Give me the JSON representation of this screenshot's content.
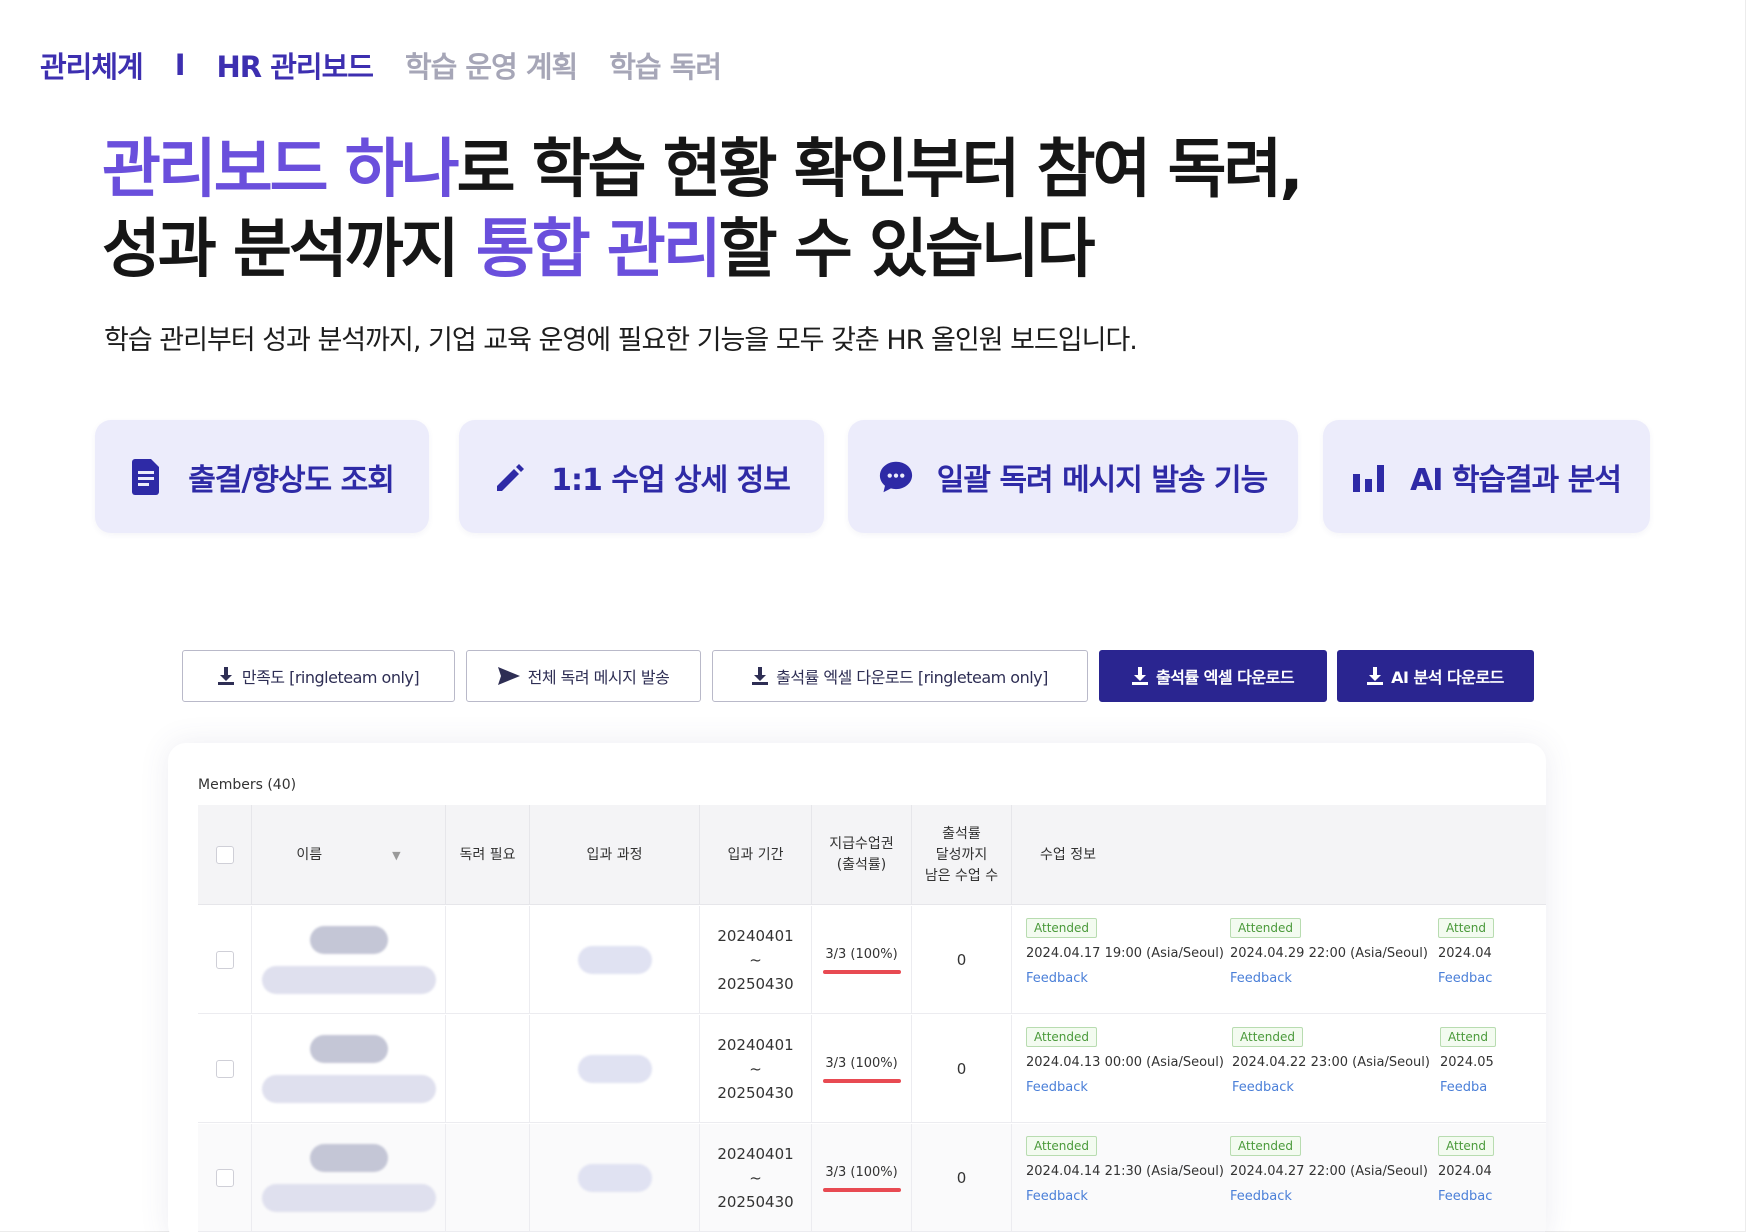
{
  "nav": {
    "item_1": "관리체계",
    "separator": "I",
    "item_2": "HR 관리보드",
    "item_3": "학습 운영 계획",
    "item_4": "학습 독려"
  },
  "hero": {
    "line1_highlight": "관리보드 하나",
    "line1_rest": "로 학습 현황 확인부터 참여 독려,",
    "line2_start": "성과 분석까지 ",
    "line2_highlight": "통합 관리",
    "line2_end": "할 수 있습니다",
    "subtitle": "학습 관리부터 성과 분석까지, 기업 교육 운영에 필요한 기능을 모두 갖춘 HR 올인원 보드입니다.",
    "accent_color": "#6a4fdc"
  },
  "features": [
    {
      "label": "출결/향상도 조회",
      "icon": "document-icon"
    },
    {
      "label": "1:1 수업 상세 정보",
      "icon": "pencil-icon"
    },
    {
      "label": "일괄 독려 메시지 발송 기능",
      "icon": "chat-bubble-icon"
    },
    {
      "label": "AI 학습결과 분석",
      "icon": "bar-chart-icon"
    }
  ],
  "toolbar": {
    "btn_satisfaction": "만족도 [ringleteam only]",
    "btn_send_all": "전체 독려 메시지 발송",
    "btn_attendance_excel_team": "출석률 엑셀 다운로드 [ringleteam only]",
    "btn_attendance_excel": "출석률 엑셀 다운로드",
    "btn_ai_download": "AI 분석 다운로드",
    "primary_color": "#2a2590"
  },
  "table": {
    "members_label": "Members (40)",
    "headers": {
      "name": "이름",
      "needs_encouragement": "독려 필요",
      "course": "입과 과정",
      "period": "입과 기간",
      "tickets_line1": "지급수업권",
      "tickets_line2": "(출석률)",
      "remaining_line1": "출석률",
      "remaining_line2": "달성까지",
      "remaining_line3": "남은 수업 수",
      "class_info": "수업 정보"
    },
    "rows": [
      {
        "period_start": "20240401",
        "period_sep": "~",
        "period_end": "20250430",
        "attendance": "3/3 (100%)",
        "remaining": "0",
        "classes": [
          {
            "status": "Attended",
            "date": "2024.04.17 19:00 (Asia/Seoul)",
            "feedback": "Feedback"
          },
          {
            "status": "Attended",
            "date": "2024.04.29 22:00 (Asia/Seoul)",
            "feedback": "Feedback"
          },
          {
            "status": "Attend",
            "date": "2024.04",
            "feedback": "Feedbac"
          }
        ]
      },
      {
        "period_start": "20240401",
        "period_sep": "~",
        "period_end": "20250430",
        "attendance": "3/3 (100%)",
        "remaining": "0",
        "classes": [
          {
            "status": "Attended",
            "date": "2024.04.13 00:00 (Asia/Seoul)",
            "feedback": "Feedback"
          },
          {
            "status": "Attended",
            "date": "2024.04.22 23:00 (Asia/Seoul)",
            "feedback": "Feedback"
          },
          {
            "status": "Attend",
            "date": "2024.05",
            "feedback": "Feedba"
          }
        ]
      },
      {
        "period_start": "20240401",
        "period_sep": "~",
        "period_end": "20250430",
        "attendance": "3/3 (100%)",
        "remaining": "0",
        "classes": [
          {
            "status": "Attended",
            "date": "2024.04.14 21:30 (Asia/Seoul)",
            "feedback": "Feedback"
          },
          {
            "status": "Attended",
            "date": "2024.04.27 22:00 (Asia/Seoul)",
            "feedback": "Feedback"
          },
          {
            "status": "Attend",
            "date": "2024.04",
            "feedback": "Feedbac"
          }
        ]
      }
    ]
  }
}
